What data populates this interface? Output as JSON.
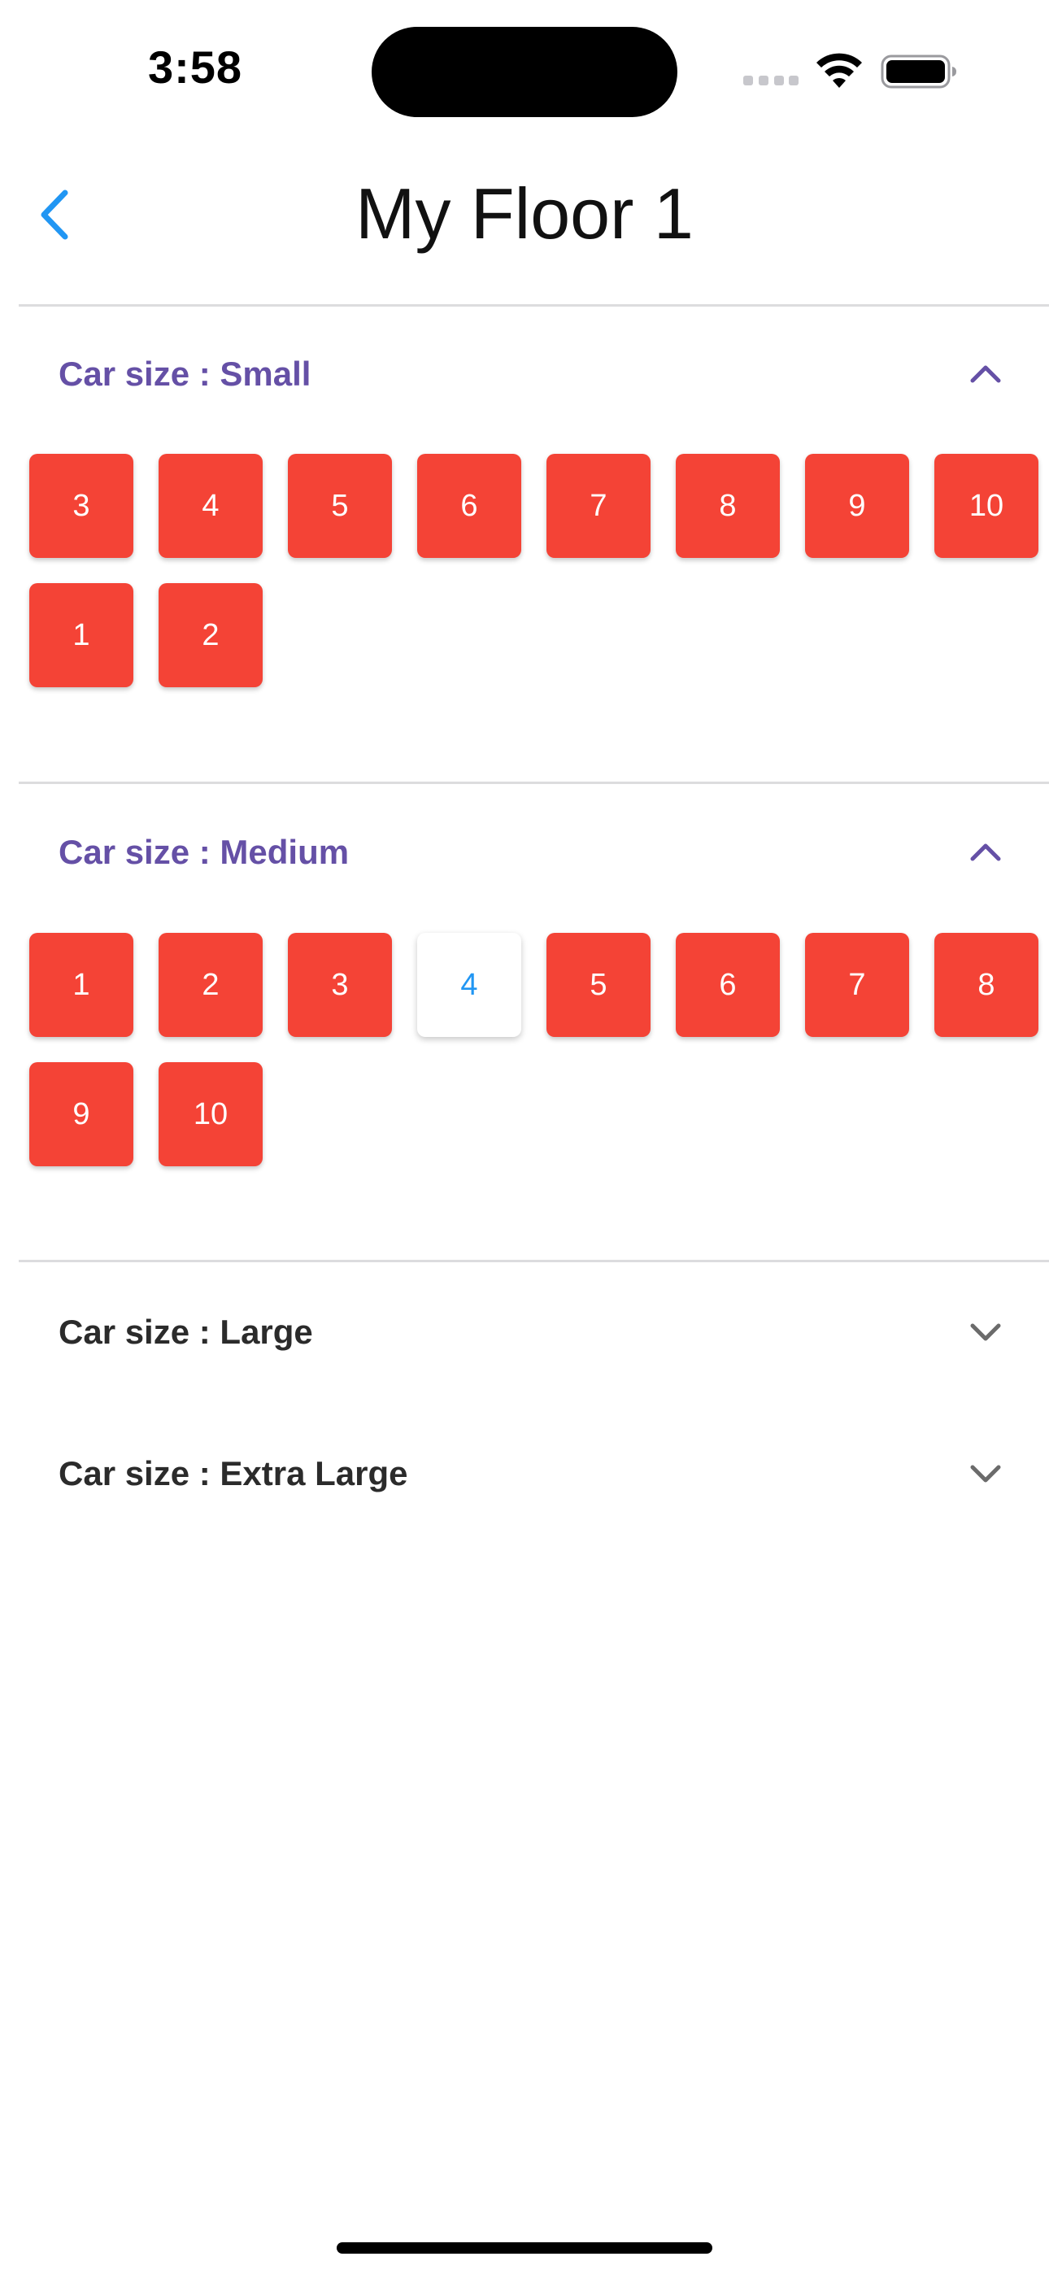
{
  "status_bar": {
    "time": "3:58"
  },
  "nav": {
    "title": "My Floor 1",
    "back_icon": "chevron-left-icon",
    "accent": "#2196f3"
  },
  "sections": [
    {
      "title": "Car size : Small",
      "expanded": true,
      "slots": [
        {
          "label": "3",
          "state": "occupied"
        },
        {
          "label": "4",
          "state": "occupied"
        },
        {
          "label": "5",
          "state": "occupied"
        },
        {
          "label": "6",
          "state": "occupied"
        },
        {
          "label": "7",
          "state": "occupied"
        },
        {
          "label": "8",
          "state": "occupied"
        },
        {
          "label": "9",
          "state": "occupied"
        },
        {
          "label": "10",
          "state": "occupied"
        },
        {
          "label": "1",
          "state": "occupied"
        },
        {
          "label": "2",
          "state": "occupied"
        }
      ]
    },
    {
      "title": "Car size : Medium",
      "expanded": true,
      "slots": [
        {
          "label": "1",
          "state": "occupied"
        },
        {
          "label": "2",
          "state": "occupied"
        },
        {
          "label": "3",
          "state": "occupied"
        },
        {
          "label": "4",
          "state": "available"
        },
        {
          "label": "5",
          "state": "occupied"
        },
        {
          "label": "6",
          "state": "occupied"
        },
        {
          "label": "7",
          "state": "occupied"
        },
        {
          "label": "8",
          "state": "occupied"
        },
        {
          "label": "9",
          "state": "occupied"
        },
        {
          "label": "10",
          "state": "occupied"
        }
      ]
    },
    {
      "title": "Car size : Large",
      "expanded": false,
      "slots": []
    },
    {
      "title": "Car size : Extra Large",
      "expanded": false,
      "slots": []
    }
  ],
  "colors": {
    "occupied": "#f44336",
    "available": "#ffffff",
    "available_text": "#2196f3",
    "expanded_title": "#6550a6",
    "collapsed_title": "#2b2b2b"
  }
}
